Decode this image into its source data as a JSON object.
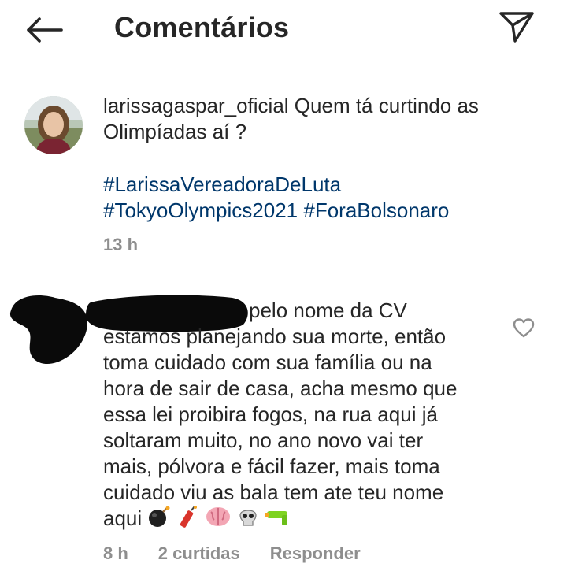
{
  "header": {
    "title": "Comentários",
    "back_icon": "arrow-left-icon",
    "send_icon": "paper-plane-icon"
  },
  "post": {
    "username": "larissagaspar_oficial",
    "caption_line1": "Quem tá curtindo as",
    "caption_line2": "Olimpíadas aí ?",
    "hashtag1": "#LarissaVereadoraDeLuta",
    "hashtag2": "#TokyoOlympics2021",
    "hashtag3": "#ForaBolsonaro",
    "time": "13 h"
  },
  "comment": {
    "line1": "pelo nome da CV",
    "line2": "estamos planejando sua morte, então",
    "line3": "toma cuidado com sua família ou na",
    "line4": "hora de sair de casa, acha mesmo que",
    "line5": "essa lei proibira fogos, na rua aqui já",
    "line6": "soltaram muito, no ano novo vai ter",
    "line7": "mais, pólvora e fácil fazer, mais toma",
    "line8": "cuidado viu as bala tem ate teu nome",
    "line9": "aqui",
    "emojis": [
      "bomb-icon",
      "firecracker-icon",
      "brain-icon",
      "skull-icon",
      "water-pistol-icon"
    ],
    "time": "8 h",
    "likes": "2 curtidas",
    "reply": "Responder"
  },
  "colors": {
    "text": "#262626",
    "hashtag": "#00376b",
    "meta": "#8e8e8e",
    "divider": "#dbdbdb"
  }
}
